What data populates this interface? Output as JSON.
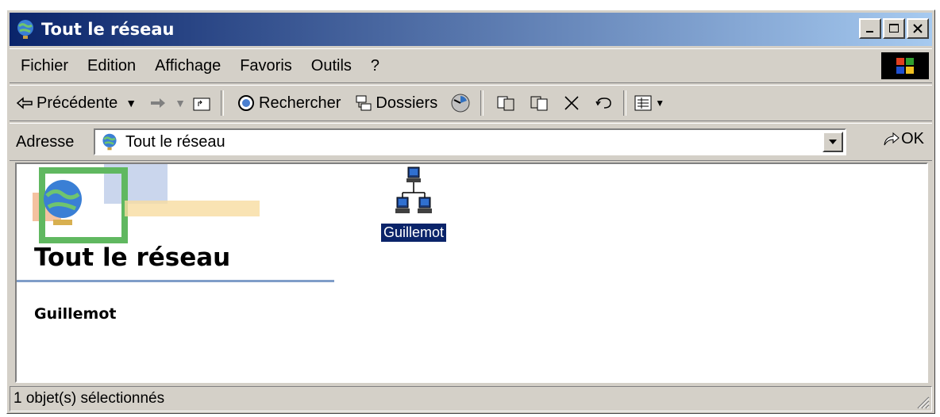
{
  "window": {
    "title": "Tout le réseau"
  },
  "menu": [
    "Fichier",
    "Edition",
    "Affichage",
    "Favoris",
    "Outils",
    "?"
  ],
  "toolbar": {
    "back": "Précédente",
    "search": "Rechercher",
    "folders": "Dossiers"
  },
  "address": {
    "label": "Adresse",
    "value": "Tout le réseau",
    "go": "OK"
  },
  "content": {
    "heading": "Tout le réseau",
    "selected_name": "Guillemot",
    "item_label": "Guillemot"
  },
  "status": {
    "text": "1 objet(s) sélectionnés"
  },
  "colors": {
    "title_start": "#0a246a",
    "title_end": "#a6caf0",
    "selection": "#0a246a"
  }
}
